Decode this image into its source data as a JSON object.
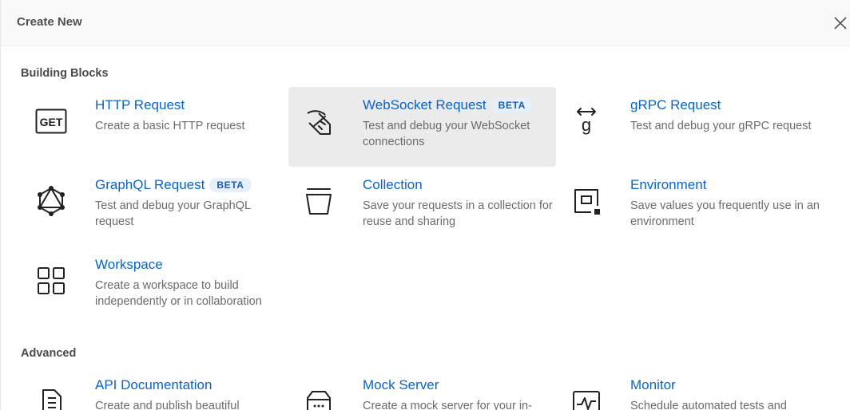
{
  "header": {
    "title": "Create New"
  },
  "sections": {
    "building_blocks": "Building Blocks",
    "advanced": "Advanced"
  },
  "tiles": {
    "http": {
      "name": "HTTP Request",
      "desc": "Create a basic HTTP request",
      "icon": "get-icon"
    },
    "websocket": {
      "name": "WebSocket Request",
      "badge": "BETA",
      "desc": "Test and debug your WebSocket connections",
      "icon": "websocket-icon"
    },
    "grpc": {
      "name": "gRPC Request",
      "desc": "Test and debug your gRPC request",
      "icon": "grpc-icon"
    },
    "graphql": {
      "name": "GraphQL Request",
      "badge": "BETA",
      "desc": "Test and debug your GraphQL request",
      "icon": "graphql-icon"
    },
    "collection": {
      "name": "Collection",
      "desc": "Save your requests in a collection for reuse and sharing",
      "icon": "collection-icon"
    },
    "environment": {
      "name": "Environment",
      "desc": "Save values you frequently use in an environment",
      "icon": "environment-icon"
    },
    "workspace": {
      "name": "Workspace",
      "desc": "Create a workspace to build independently or in collaboration",
      "icon": "workspace-icon"
    },
    "apidoc": {
      "name": "API Documentation",
      "desc": "Create and publish beautiful",
      "icon": "document-icon"
    },
    "mock": {
      "name": "Mock Server",
      "desc": "Create a mock server for your in-",
      "icon": "server-icon"
    },
    "monitor": {
      "name": "Monitor",
      "desc": "Schedule automated tests and",
      "icon": "monitor-icon"
    }
  },
  "colors": {
    "link": "#0a63c9",
    "badge_bg": "#e5f0fb",
    "highlight_bg": "#ebebeb",
    "header_bg": "#f9f9f9"
  }
}
